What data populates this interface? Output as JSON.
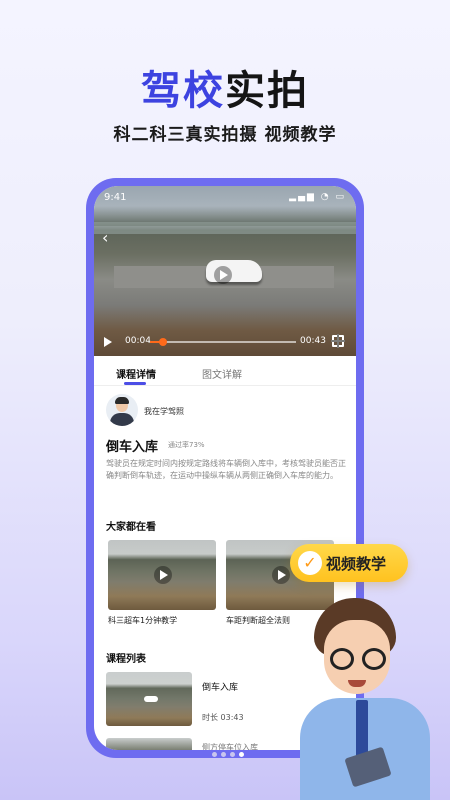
{
  "hero": {
    "title_part1": "驾校",
    "title_part2": "实拍",
    "subtitle": "科二科三真实拍摄 视频教学"
  },
  "status_bar": {
    "time": "9:41",
    "icons": "signal wifi battery"
  },
  "video": {
    "current_time": "00:04",
    "total_time": "00:43",
    "progress_fraction": 0.09
  },
  "tabs": [
    {
      "label": "课程详情",
      "active": true
    },
    {
      "label": "图文详解",
      "active": false
    }
  ],
  "author": {
    "name": "我在学驾照"
  },
  "lesson": {
    "title": "倒车入库",
    "pass_rate": "通过率73%",
    "description": "驾驶员在规定时间内按规定路线将车辆倒入库中，考核驾驶员能否正确判断倒车轨迹，在运动中操纵车辆从两侧正确倒入车库的能力。"
  },
  "watching": {
    "title": "大家都在看",
    "items": [
      {
        "label": "科三超车1分钟教学"
      },
      {
        "label": "车距判断超全法则"
      }
    ]
  },
  "course_list": {
    "title": "课程列表",
    "items": [
      {
        "title": "倒车入库",
        "duration": "时长 03:43"
      },
      {
        "title": "侧方停车位入库"
      }
    ]
  },
  "badge": {
    "label": "视频教学",
    "icon": "check-icon"
  },
  "pager": {
    "count": 4,
    "active_index": 3
  },
  "colors": {
    "accent": "#4c4ee6",
    "progress": "#ff6a1a",
    "badge": "#ffc21f"
  }
}
